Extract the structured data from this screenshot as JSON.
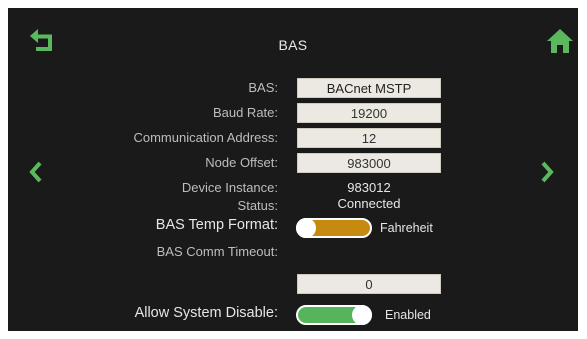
{
  "screen": {
    "title": "BAS"
  },
  "nav": {
    "back_icon": "back-arrow-icon",
    "home_icon": "home-icon",
    "prev_icon": "chevron-left-icon",
    "next_icon": "chevron-right-icon",
    "accent_color": "#5bb85f"
  },
  "fields": {
    "bas": {
      "label": "BAS:",
      "value": "BACnet MSTP"
    },
    "baud": {
      "label": "Baud Rate:",
      "value": "19200"
    },
    "comm_addr": {
      "label": "Communication Address:",
      "value": "12"
    },
    "node_off": {
      "label": "Node Offset:",
      "value": "983000"
    },
    "dev_inst": {
      "label": "Device Instance:",
      "value": "983012"
    },
    "status": {
      "label": "Status:",
      "value": "Connected"
    },
    "temp_fmt": {
      "label": "BAS Temp Format:",
      "value": "Fahreheit",
      "toggle_color": "#c78a10"
    },
    "comm_to": {
      "label": "BAS Comm Timeout:",
      "value": "0"
    },
    "sys_dis": {
      "label": "Allow System Disable:",
      "value": "Enabled",
      "toggle_color": "#56b45a"
    }
  }
}
